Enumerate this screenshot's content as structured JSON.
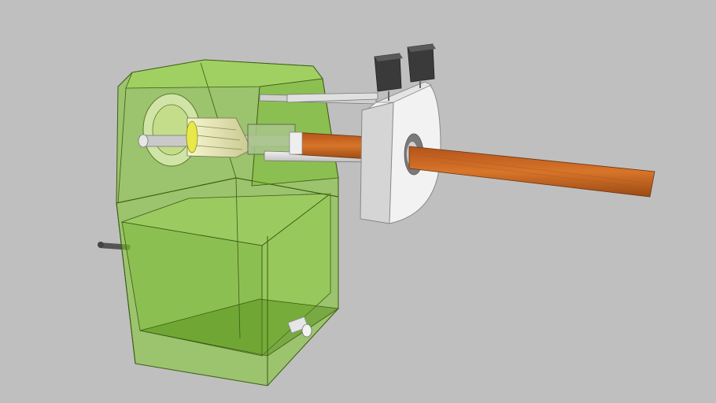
{
  "scene": {
    "description_visible_text": "",
    "colors": {
      "background": "#bfbfbf",
      "housing_fill": "#7fc72a",
      "housing_edge": "#3c5a14",
      "pencil_wood": "#c8621e",
      "pencil_wood_dark": "#9a4a14",
      "metal_light": "#e6e6e6",
      "metal_mid": "#c9c9c9",
      "metal_dark": "#8f8f8f",
      "cutter_yellow": "#e8e84a",
      "clip_black": "#3a3a3a",
      "crank_rod": "#555555"
    }
  }
}
